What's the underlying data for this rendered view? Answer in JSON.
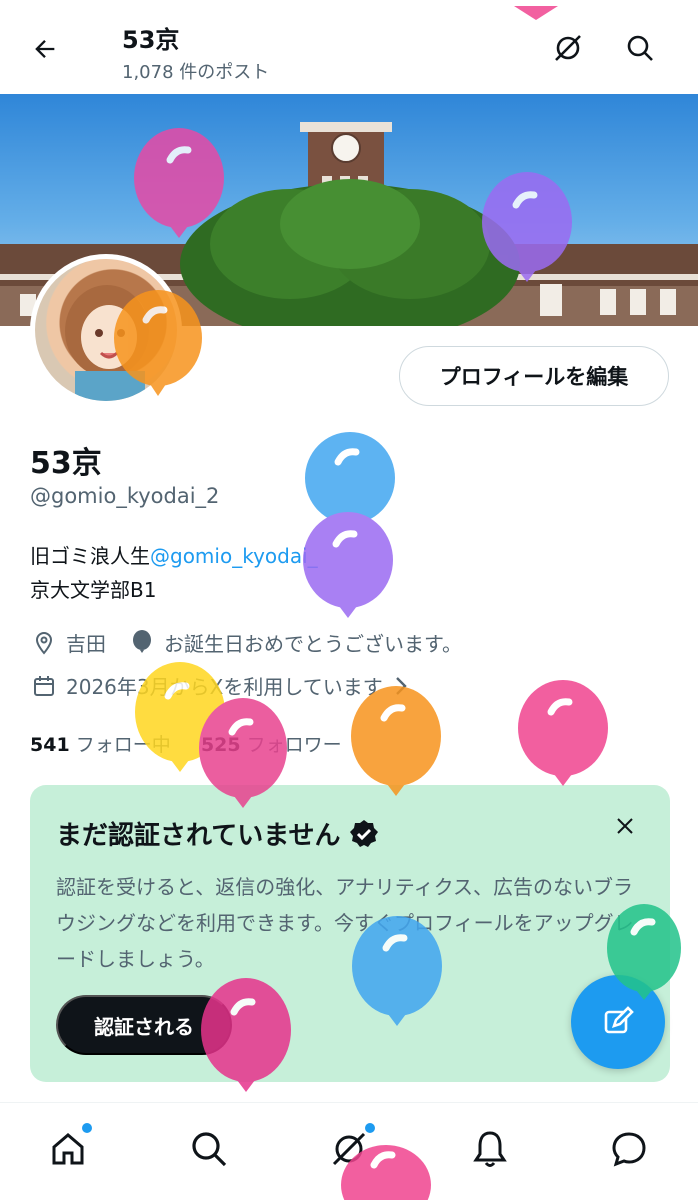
{
  "header": {
    "title": "53京",
    "post_count": "1,078 件のポスト"
  },
  "profile": {
    "edit_button": "プロフィールを編集",
    "name": "53京",
    "handle": "@gomio_kyodai_2",
    "bio_prefix": "旧ゴミ浪人生",
    "bio_link": "@gomio_kyodai_",
    "bio_line2": "京大文学部B1",
    "location": "吉田",
    "birthday_text": "お誕生日おめでとうございます。",
    "joined": "2026年3月からXを利用しています",
    "following_count": "541",
    "following_label": "フォロー中",
    "followers_count": "525",
    "followers_label": "フォロワー"
  },
  "verify_card": {
    "title": "まだ認証されていません",
    "description": "認証を受けると、返信の強化、アナリティクス、広告のないブラウジングなどを利用できます。今すぐプロフィールをアップグレードしましょう。",
    "button": "認証される"
  },
  "bottom_nav": [
    "home-icon",
    "search-icon",
    "grok-icon",
    "notifications-icon",
    "messages-icon"
  ],
  "colors": {
    "accent": "#1d9bf0",
    "verify_bg": "#c6efd9",
    "text": "#0f1419",
    "muted": "#536471"
  }
}
